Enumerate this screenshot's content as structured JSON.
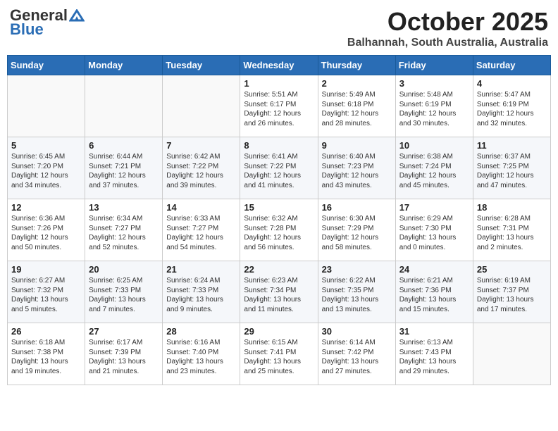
{
  "header": {
    "logo_general": "General",
    "logo_blue": "Blue",
    "month": "October 2025",
    "location": "Balhannah, South Australia, Australia"
  },
  "days_of_week": [
    "Sunday",
    "Monday",
    "Tuesday",
    "Wednesday",
    "Thursday",
    "Friday",
    "Saturday"
  ],
  "weeks": [
    [
      {
        "day": "",
        "info": ""
      },
      {
        "day": "",
        "info": ""
      },
      {
        "day": "",
        "info": ""
      },
      {
        "day": "1",
        "info": "Sunrise: 5:51 AM\nSunset: 6:17 PM\nDaylight: 12 hours\nand 26 minutes."
      },
      {
        "day": "2",
        "info": "Sunrise: 5:49 AM\nSunset: 6:18 PM\nDaylight: 12 hours\nand 28 minutes."
      },
      {
        "day": "3",
        "info": "Sunrise: 5:48 AM\nSunset: 6:19 PM\nDaylight: 12 hours\nand 30 minutes."
      },
      {
        "day": "4",
        "info": "Sunrise: 5:47 AM\nSunset: 6:19 PM\nDaylight: 12 hours\nand 32 minutes."
      }
    ],
    [
      {
        "day": "5",
        "info": "Sunrise: 6:45 AM\nSunset: 7:20 PM\nDaylight: 12 hours\nand 34 minutes."
      },
      {
        "day": "6",
        "info": "Sunrise: 6:44 AM\nSunset: 7:21 PM\nDaylight: 12 hours\nand 37 minutes."
      },
      {
        "day": "7",
        "info": "Sunrise: 6:42 AM\nSunset: 7:22 PM\nDaylight: 12 hours\nand 39 minutes."
      },
      {
        "day": "8",
        "info": "Sunrise: 6:41 AM\nSunset: 7:22 PM\nDaylight: 12 hours\nand 41 minutes."
      },
      {
        "day": "9",
        "info": "Sunrise: 6:40 AM\nSunset: 7:23 PM\nDaylight: 12 hours\nand 43 minutes."
      },
      {
        "day": "10",
        "info": "Sunrise: 6:38 AM\nSunset: 7:24 PM\nDaylight: 12 hours\nand 45 minutes."
      },
      {
        "day": "11",
        "info": "Sunrise: 6:37 AM\nSunset: 7:25 PM\nDaylight: 12 hours\nand 47 minutes."
      }
    ],
    [
      {
        "day": "12",
        "info": "Sunrise: 6:36 AM\nSunset: 7:26 PM\nDaylight: 12 hours\nand 50 minutes."
      },
      {
        "day": "13",
        "info": "Sunrise: 6:34 AM\nSunset: 7:27 PM\nDaylight: 12 hours\nand 52 minutes."
      },
      {
        "day": "14",
        "info": "Sunrise: 6:33 AM\nSunset: 7:27 PM\nDaylight: 12 hours\nand 54 minutes."
      },
      {
        "day": "15",
        "info": "Sunrise: 6:32 AM\nSunset: 7:28 PM\nDaylight: 12 hours\nand 56 minutes."
      },
      {
        "day": "16",
        "info": "Sunrise: 6:30 AM\nSunset: 7:29 PM\nDaylight: 12 hours\nand 58 minutes."
      },
      {
        "day": "17",
        "info": "Sunrise: 6:29 AM\nSunset: 7:30 PM\nDaylight: 13 hours\nand 0 minutes."
      },
      {
        "day": "18",
        "info": "Sunrise: 6:28 AM\nSunset: 7:31 PM\nDaylight: 13 hours\nand 2 minutes."
      }
    ],
    [
      {
        "day": "19",
        "info": "Sunrise: 6:27 AM\nSunset: 7:32 PM\nDaylight: 13 hours\nand 5 minutes."
      },
      {
        "day": "20",
        "info": "Sunrise: 6:25 AM\nSunset: 7:33 PM\nDaylight: 13 hours\nand 7 minutes."
      },
      {
        "day": "21",
        "info": "Sunrise: 6:24 AM\nSunset: 7:33 PM\nDaylight: 13 hours\nand 9 minutes."
      },
      {
        "day": "22",
        "info": "Sunrise: 6:23 AM\nSunset: 7:34 PM\nDaylight: 13 hours\nand 11 minutes."
      },
      {
        "day": "23",
        "info": "Sunrise: 6:22 AM\nSunset: 7:35 PM\nDaylight: 13 hours\nand 13 minutes."
      },
      {
        "day": "24",
        "info": "Sunrise: 6:21 AM\nSunset: 7:36 PM\nDaylight: 13 hours\nand 15 minutes."
      },
      {
        "day": "25",
        "info": "Sunrise: 6:19 AM\nSunset: 7:37 PM\nDaylight: 13 hours\nand 17 minutes."
      }
    ],
    [
      {
        "day": "26",
        "info": "Sunrise: 6:18 AM\nSunset: 7:38 PM\nDaylight: 13 hours\nand 19 minutes."
      },
      {
        "day": "27",
        "info": "Sunrise: 6:17 AM\nSunset: 7:39 PM\nDaylight: 13 hours\nand 21 minutes."
      },
      {
        "day": "28",
        "info": "Sunrise: 6:16 AM\nSunset: 7:40 PM\nDaylight: 13 hours\nand 23 minutes."
      },
      {
        "day": "29",
        "info": "Sunrise: 6:15 AM\nSunset: 7:41 PM\nDaylight: 13 hours\nand 25 minutes."
      },
      {
        "day": "30",
        "info": "Sunrise: 6:14 AM\nSunset: 7:42 PM\nDaylight: 13 hours\nand 27 minutes."
      },
      {
        "day": "31",
        "info": "Sunrise: 6:13 AM\nSunset: 7:43 PM\nDaylight: 13 hours\nand 29 minutes."
      },
      {
        "day": "",
        "info": ""
      }
    ]
  ]
}
